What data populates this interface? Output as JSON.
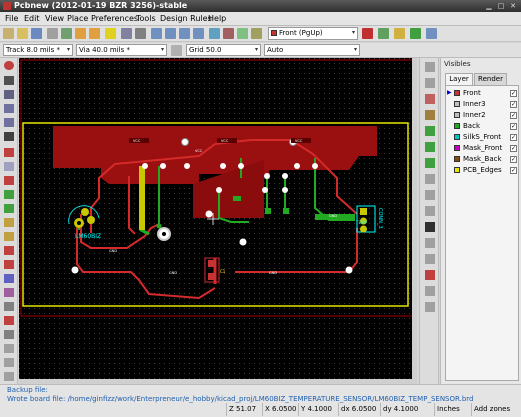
{
  "window": {
    "title": "Pcbnew (2012-01-19 BZR 3256)-stable"
  },
  "menu": [
    "File",
    "Edit",
    "View",
    "Place",
    "Preferences",
    "Tools",
    "Design Rules",
    "Help"
  ],
  "toolbar": {
    "layer_select": "Front (PgUp)"
  },
  "aux": {
    "track": "Track 8.0 mils *",
    "via": "Via 40.0 mils *",
    "grid": "Grid 50.0",
    "zoom": "Auto"
  },
  "visibles": {
    "title": "Visibles",
    "tabs": [
      "Layer",
      "Render"
    ],
    "layers": [
      {
        "name": "Front",
        "color": "#c83232",
        "checked": true,
        "current": true
      },
      {
        "name": "Inner3",
        "color": "#c0c0c0",
        "checked": true,
        "current": false
      },
      {
        "name": "Inner2",
        "color": "#c0c0c0",
        "checked": true,
        "current": false
      },
      {
        "name": "Back",
        "color": "#22aa22",
        "checked": true,
        "current": false
      },
      {
        "name": "SilkS_Front",
        "color": "#00c8c8",
        "checked": true,
        "current": false
      },
      {
        "name": "Mask_Front",
        "color": "#c800c8",
        "checked": true,
        "current": false
      },
      {
        "name": "Mask_Back",
        "color": "#8a4a10",
        "checked": true,
        "current": false
      },
      {
        "name": "PCB_Edges",
        "color": "#e6e600",
        "checked": true,
        "current": false
      }
    ]
  },
  "board": {
    "labels": [
      {
        "text": "LM60BIZ",
        "color": "#00ffff"
      },
      {
        "text": "CONN_3",
        "color": "#00ffff"
      },
      {
        "text": "TEMP",
        "color": "#00ffff"
      },
      {
        "text": "C1",
        "color": "#ffff00"
      },
      {
        "text": "VCC",
        "color": "#ffffff"
      },
      {
        "text": "VCC",
        "color": "#ffffff"
      },
      {
        "text": "VCC",
        "color": "#ffffff"
      },
      {
        "text": "VCC",
        "color": "#ffffff"
      },
      {
        "text": "GND",
        "color": "#ffffff"
      },
      {
        "text": "GND",
        "color": "#ffffff"
      },
      {
        "text": "GND",
        "color": "#ffffff"
      },
      {
        "text": "GND",
        "color": "#ffffff"
      }
    ]
  },
  "messages": {
    "line1": "Backup file:",
    "line2": "Wrote board file: /home/ginfizz/work/Enterpreneur/e_hobby/kicad_proj/LM60BIZ_TEMPERATURE_SENSOR/LM60BIZ_TEMP_SENSOR.brd"
  },
  "status": {
    "zoom": "Z 51.07",
    "x": "X 6.0500",
    "y": "Y 4.1000",
    "dx": "dx 6.0500",
    "dy": "dy 4.1000",
    "units": "Inches",
    "mode": "Add zones"
  }
}
